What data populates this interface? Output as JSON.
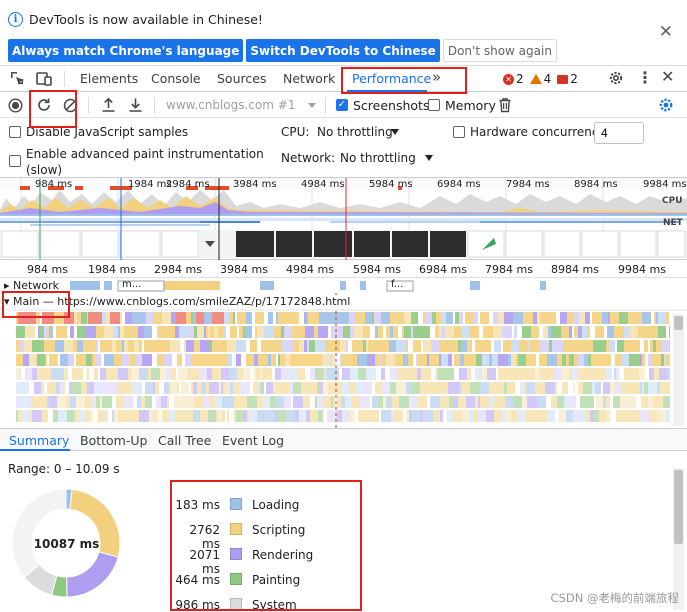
{
  "infobar": {
    "message": "DevTools is now available in Chinese!",
    "btn_match": "Always match Chrome's language",
    "btn_switch": "Switch DevTools to Chinese",
    "btn_dismiss": "Don't show again"
  },
  "tabs": {
    "elements": "Elements",
    "console": "Console",
    "sources": "Sources",
    "network": "Network",
    "performance": "Performance",
    "more": "»",
    "errors": "2",
    "warnings": "4",
    "issues": "2"
  },
  "perf_toolbar": {
    "url": "www.cnblogs.com #1",
    "screenshots_label": "Screenshots",
    "screenshots_checked": true,
    "memory_label": "Memory",
    "memory_checked": false
  },
  "settings": {
    "disable_js_samples": "Disable JavaScript samples",
    "advanced_paint": "Enable advanced paint instrumentation",
    "advanced_paint_note": "(slow)",
    "cpu_label": "CPU:",
    "cpu_value": "No throttling",
    "network_label": "Network:",
    "network_value": "No throttling",
    "hw_concurrency_label": "Hardware concurrency",
    "hw_concurrency_value": "4"
  },
  "overview": {
    "ticks": [
      "984 ms",
      "1984 ms",
      "2984 ms",
      "3984 ms",
      "4984 ms",
      "5984 ms",
      "6984 ms",
      "7984 ms",
      "8984 ms",
      "9984 ms"
    ],
    "cpu_label": "CPU",
    "net_label": "NET"
  },
  "flame": {
    "ticks": [
      "984 ms",
      "1984 ms",
      "2984 ms",
      "3984 ms",
      "4984 ms",
      "5984 ms",
      "6984 ms",
      "7984 ms",
      "8984 ms",
      "9984 ms"
    ],
    "network_track": "Network",
    "network_chunk_1": "m...",
    "network_chunk_2": "f...",
    "main_track": "Main — https://www.cnblogs.com/smileZAZ/p/17172848.html"
  },
  "bottom_tabs": {
    "summary": "Summary",
    "bottom_up": "Bottom-Up",
    "call_tree": "Call Tree",
    "event_log": "Event Log"
  },
  "summary": {
    "range": "Range: 0 – 10.09 s",
    "total": "10087 ms",
    "items": [
      {
        "value": "183 ms",
        "name": "Loading",
        "color": "#9fc0e8",
        "ms": 183
      },
      {
        "value": "2762 ms",
        "name": "Scripting",
        "color": "#f3d07d",
        "ms": 2762
      },
      {
        "value": "2071 ms",
        "name": "Rendering",
        "color": "#af9df2",
        "ms": 2071
      },
      {
        "value": "464 ms",
        "name": "Painting",
        "color": "#8ec980",
        "ms": 464
      },
      {
        "value": "986 ms",
        "name": "System",
        "color": "#dadce0",
        "ms": 986
      }
    ],
    "idle_ms": 3621,
    "idle_color": "#f1f3f4"
  },
  "watermark": "CSDN @老梅的前端旅程",
  "colors": {
    "accent": "#1a73e8",
    "annotation": "#e0201b"
  }
}
